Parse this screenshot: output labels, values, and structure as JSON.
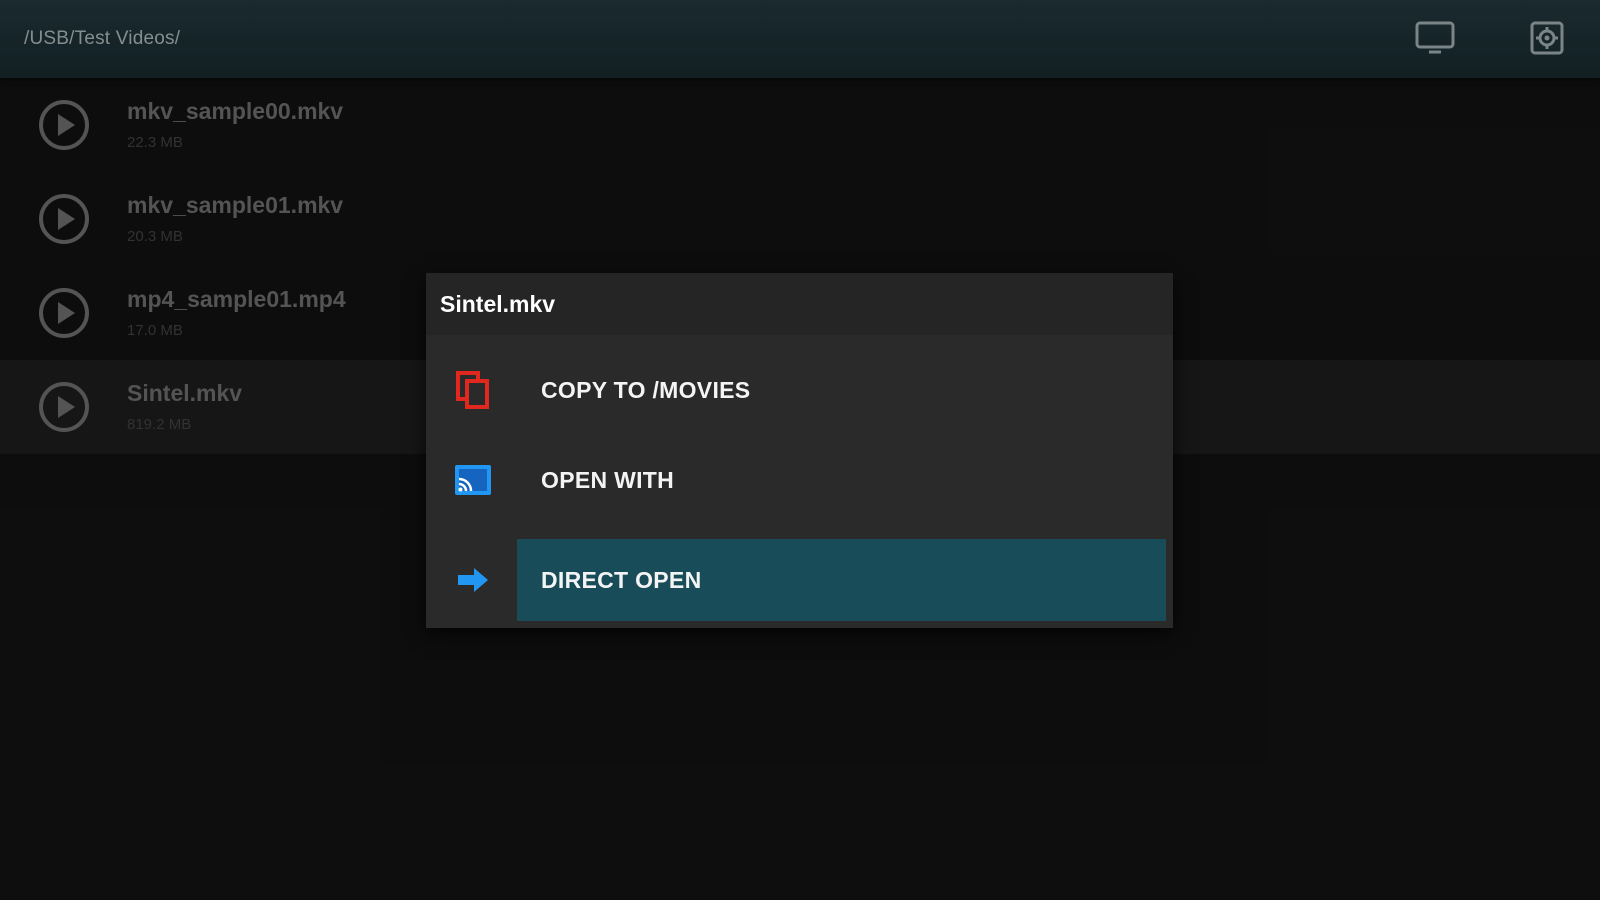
{
  "header": {
    "path": "/USB/Test Videos/",
    "icons": [
      "tv-icon",
      "settings-icon"
    ]
  },
  "files": [
    {
      "name": "mkv_sample00.mkv",
      "size": "22.3 MB",
      "icon": "play-icon"
    },
    {
      "name": "mkv_sample01.mkv",
      "size": "20.3 MB",
      "icon": "play-icon"
    },
    {
      "name": "mp4_sample01.mp4",
      "size": "17.0 MB",
      "icon": "play-icon"
    },
    {
      "name": "Sintel.mkv",
      "size": "819.2 MB",
      "icon": "play-icon"
    }
  ],
  "dialog": {
    "title": "Sintel.mkv",
    "items": [
      {
        "label": "COPY TO /MOVIES",
        "icon": "copy-icon",
        "icon_color": "#e0281f"
      },
      {
        "label": "OPEN WITH",
        "icon": "cast-icon",
        "icon_color": "#2196f3"
      },
      {
        "label": "DIRECT OPEN",
        "icon": "arrow-right-icon",
        "icon_color": "#2196f3",
        "highlighted": true
      }
    ]
  },
  "colors": {
    "accent": "#174c58",
    "topbar": "#1c2f34",
    "background": "#111111"
  }
}
